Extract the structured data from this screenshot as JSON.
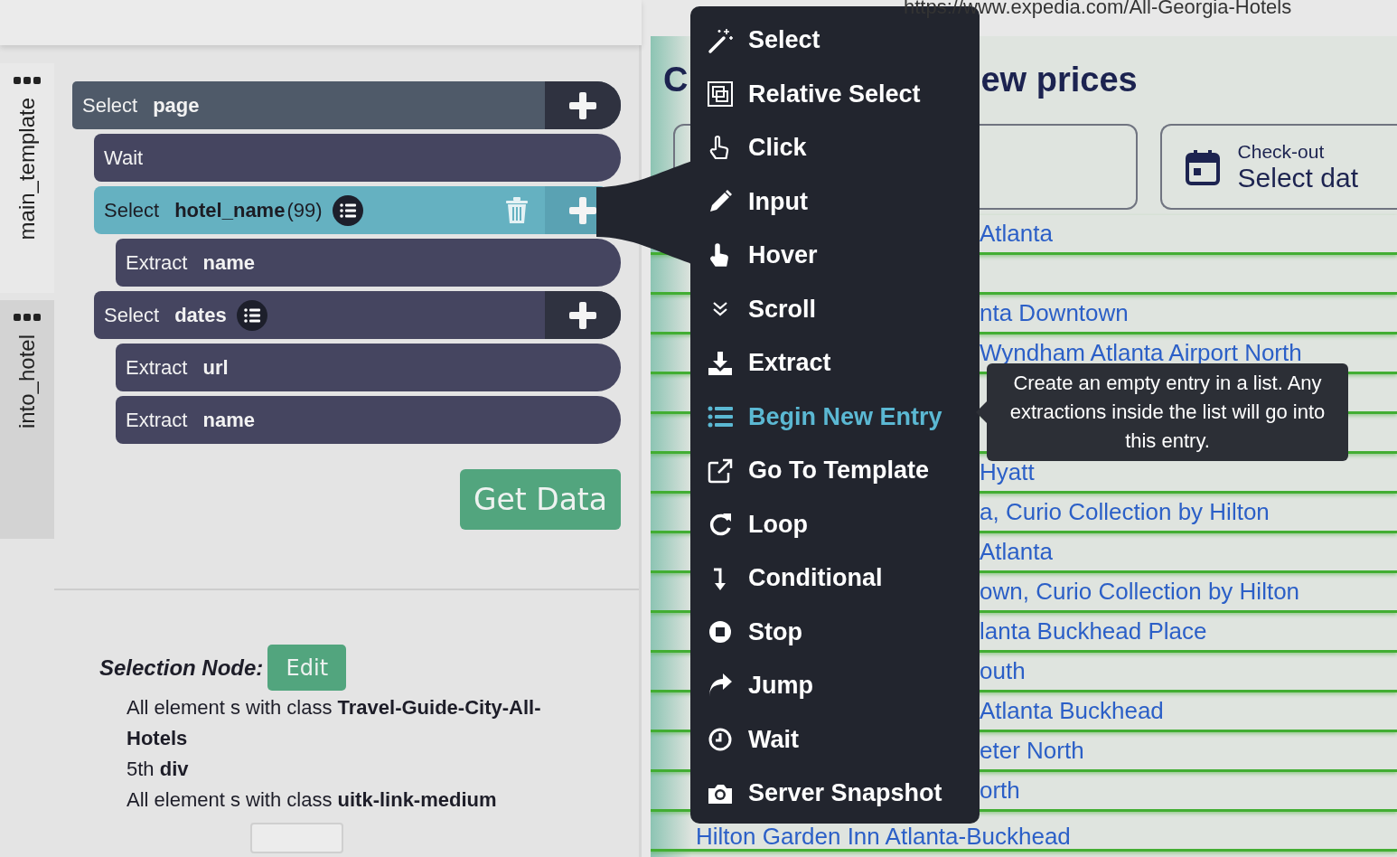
{
  "left_panel": {
    "tabs": [
      {
        "label": "main_template",
        "selected": true
      },
      {
        "label": "into_hotel",
        "selected": false
      }
    ],
    "blocks": [
      {
        "action": "Select",
        "target": "page",
        "addable": true,
        "list": false,
        "selected": false,
        "children": [
          {
            "action": "Wait",
            "addable": false,
            "list": false,
            "selected": false
          },
          {
            "action": "Select",
            "target": "hotel_name",
            "count": "(99)",
            "addable": true,
            "list": true,
            "selected": true,
            "children": [
              {
                "action": "Extract",
                "target": "name",
                "addable": false,
                "list": false,
                "selected": false
              }
            ]
          },
          {
            "action": "Select",
            "target": "dates",
            "addable": true,
            "list": true,
            "selected": false,
            "children": [
              {
                "action": "Extract",
                "target": "url",
                "addable": false,
                "list": false,
                "selected": false
              },
              {
                "action": "Extract",
                "target": "name",
                "addable": false,
                "list": false,
                "selected": false
              }
            ]
          }
        ]
      }
    ],
    "get_data_button": "Get Data",
    "selection_node": {
      "title": "Selection Node:",
      "edit_button": "Edit",
      "lines": [
        "All element s with class **Travel-Guide-City-All-Hotels**",
        "5th **div**",
        "All element s with class **uitk-link-medium**"
      ]
    }
  },
  "browser": {
    "url": "https://www.expedia.com/All-Georgia-Hotels",
    "heading_parts": [
      "C",
      "ew prices"
    ],
    "date_field": {
      "label": "Check-out",
      "value": "Select dat"
    },
    "rows": [
      {
        "kind": "clipped",
        "text": "Atlanta"
      },
      {
        "kind": "blank"
      },
      {
        "kind": "clipped",
        "text": "nta Downtown"
      },
      {
        "kind": "clipped",
        "text": "Wyndham Atlanta Airport North"
      },
      {
        "kind": "blank"
      },
      {
        "kind": "blank"
      },
      {
        "kind": "clipped",
        "text": "Hyatt"
      },
      {
        "kind": "clipped",
        "text": "a, Curio Collection by Hilton"
      },
      {
        "kind": "clipped",
        "text": "Atlanta"
      },
      {
        "kind": "clipped",
        "text": "own, Curio Collection by Hilton"
      },
      {
        "kind": "clipped",
        "text": "lanta Buckhead Place"
      },
      {
        "kind": "clipped",
        "text": "outh"
      },
      {
        "kind": "clipped",
        "text": "Atlanta Buckhead"
      },
      {
        "kind": "clipped",
        "text": "eter North"
      },
      {
        "kind": "clipped",
        "text": "orth"
      },
      {
        "kind": "full",
        "text": "Hilton Garden Inn Atlanta-Buckhead"
      }
    ]
  },
  "action_menu": {
    "items": [
      {
        "label": "Select",
        "selected": false
      },
      {
        "label": "Relative Select",
        "selected": false
      },
      {
        "label": "Click",
        "selected": false
      },
      {
        "label": "Input",
        "selected": false
      },
      {
        "label": "Hover",
        "selected": false
      },
      {
        "label": "Scroll",
        "selected": false
      },
      {
        "label": "Extract",
        "selected": false
      },
      {
        "label": "Begin New Entry",
        "selected": true
      },
      {
        "label": "Go To Template",
        "selected": false
      },
      {
        "label": "Loop",
        "selected": false
      },
      {
        "label": "Conditional",
        "selected": false
      },
      {
        "label": "Stop",
        "selected": false
      },
      {
        "label": "Jump",
        "selected": false
      },
      {
        "label": "Wait",
        "selected": false
      },
      {
        "label": "Server Snapshot",
        "selected": false
      }
    ]
  },
  "tooltip": "Create an empty entry in a list. Any extractions inside the list will go into this entry."
}
